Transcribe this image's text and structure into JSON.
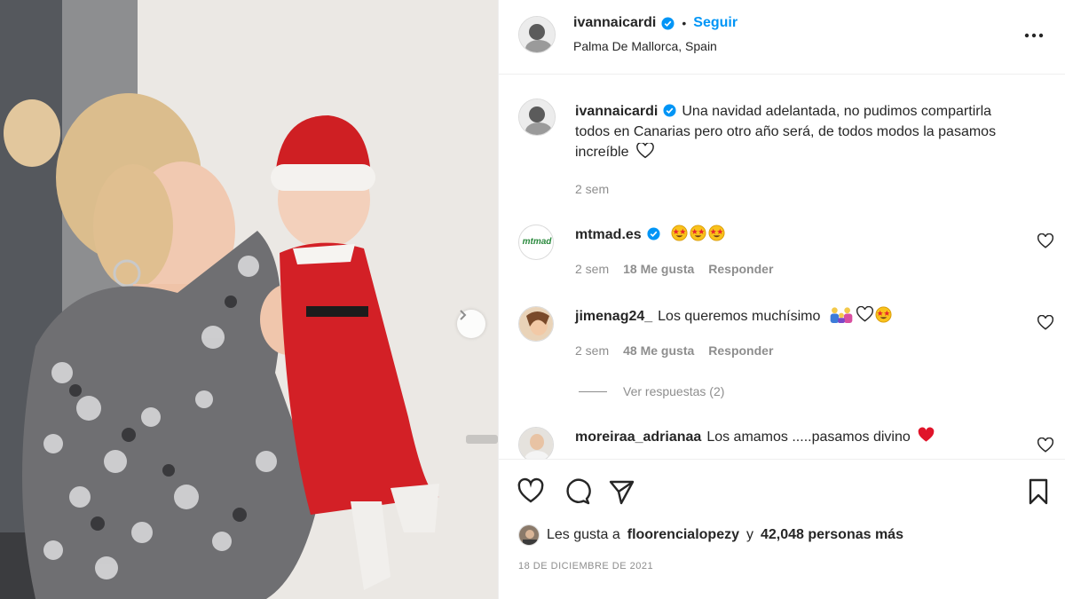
{
  "post": {
    "username": "ivannaicardi",
    "separator": "•",
    "follow_label": "Seguir",
    "location": "Palma De Mallorca, Spain"
  },
  "caption": {
    "username": "ivannaicardi",
    "text": "Una navidad adelantada, no pudimos compartirla todos en Canarias pero otro año será, de todos modos la pasamos increíble",
    "time": "2 sem"
  },
  "comments": [
    {
      "username": "mtmad.es",
      "avatar_text": "mtmad",
      "text": "",
      "emojis": [
        "star-eyes-icon",
        "star-eyes-icon",
        "star-eyes-icon"
      ],
      "time": "2 sem",
      "likes": "18 Me gusta",
      "reply_label": "Responder"
    },
    {
      "username": "jimenag24_",
      "text": "Los queremos muchísimo",
      "emojis": [
        "family-icon",
        "heart-outline-icon",
        "star-eyes-icon"
      ],
      "time": "2 sem",
      "likes": "48 Me gusta",
      "reply_label": "Responder"
    },
    {
      "username": "moreiraa_adrianaa",
      "text": "Los amamos .....pasamos divino",
      "emojis": [
        "red-heart-icon"
      ]
    }
  ],
  "view_replies": "Ver respuestas (2)",
  "likes": {
    "prefix": "Les gusta a",
    "user": "floorencialopezy",
    "conjunction": "y",
    "count": "42,048 personas más"
  },
  "date": "18 DE DICIEMBRE DE 2021",
  "colors": {
    "accent": "#0095f6",
    "text": "#262626",
    "muted": "#8e8e8e",
    "border": "#efefef"
  }
}
